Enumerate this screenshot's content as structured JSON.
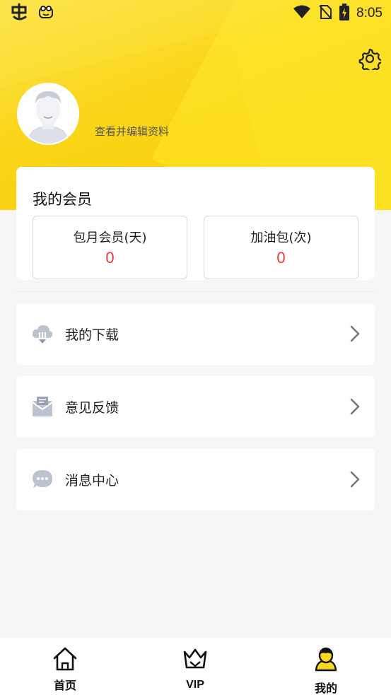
{
  "status_bar": {
    "time": "8:05",
    "icons": [
      "app-logo-icon",
      "frog-icon",
      "wifi-icon",
      "no-sim-icon",
      "battery-charging-icon"
    ]
  },
  "header": {
    "edit_profile_label": "查看并编辑资料",
    "settings_icon": "gear-icon",
    "bg_color": "#f9d71c"
  },
  "membership": {
    "title": "我的会员",
    "items": [
      {
        "label": "包月会员(天)",
        "value": "0"
      },
      {
        "label": "加油包(次)",
        "value": "0"
      }
    ],
    "value_color": "#e8393a"
  },
  "menu": [
    {
      "label": "我的下载",
      "icon": "cloud-download-icon"
    },
    {
      "label": "意见反馈",
      "icon": "feedback-mail-icon"
    },
    {
      "label": "消息中心",
      "icon": "message-bubble-icon"
    }
  ],
  "bottom_nav": [
    {
      "label": "首页",
      "icon": "home-icon"
    },
    {
      "label": "VIP",
      "icon": "crown-icon"
    },
    {
      "label": "我的",
      "icon": "user-icon",
      "active": true
    }
  ]
}
